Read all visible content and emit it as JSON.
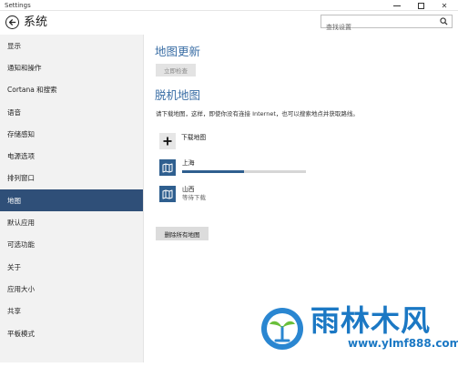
{
  "window": {
    "title": "Settings",
    "controls": {
      "minimize": "minimize",
      "maximize": "maximize",
      "close": "✕"
    }
  },
  "header": {
    "title": "系统",
    "search_placeholder": "查找设置",
    "back_icon": "back-arrow-icon",
    "search_icon": "search-icon"
  },
  "sidebar": {
    "items": [
      {
        "label": "显示"
      },
      {
        "label": "通知和操作"
      },
      {
        "label": "Cortana 和搜索"
      },
      {
        "label": "语音"
      },
      {
        "label": "存储感知"
      },
      {
        "label": "电源选项"
      },
      {
        "label": "排列窗口"
      },
      {
        "label": "地图"
      },
      {
        "label": "默认应用"
      },
      {
        "label": "可选功能"
      },
      {
        "label": "关于"
      },
      {
        "label": "应用大小"
      },
      {
        "label": "共享"
      },
      {
        "label": "平板模式"
      }
    ],
    "active_index": 7
  },
  "main": {
    "map_update_heading": "地图更新",
    "check_now_label": "立即检查",
    "offline_heading": "脱机地图",
    "description": "请下载地图，这样，即使你没有连接 Internet，也可以搜索地点并获取路线。",
    "download_label": "下载地图",
    "maps": [
      {
        "name": "上海",
        "status": "",
        "progress": 0.5
      },
      {
        "name": "山西",
        "status": "等待下载"
      }
    ],
    "delete_all_label": "删除所有地图"
  },
  "watermark": {
    "text": "雨林木风",
    "url": "www.ylmf888.com"
  },
  "colors": {
    "accent": "#2f4f78",
    "heading": "#3a6ea5",
    "map_tile": "#2f5f8f",
    "watermark": "#1b78c4"
  }
}
